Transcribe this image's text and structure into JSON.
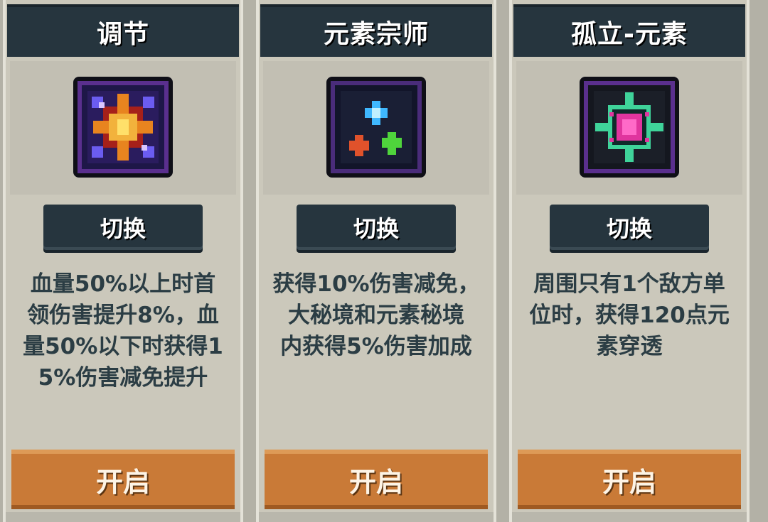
{
  "cards": [
    {
      "title": "调节",
      "icon": "starburst-gem-icon",
      "switch_label": "切换",
      "description": "血量50%以上时首\n领伤害提升8%，血\n量50%以下时获得1\n5%伤害减免提升",
      "open_label": "开启"
    },
    {
      "title": "元素宗师",
      "icon": "three-elements-icon",
      "switch_label": "切换",
      "description": "获得10%伤害减免，\n大秘境和元素秘境\n内获得5%伤害加成",
      "open_label": "开启"
    },
    {
      "title": "孤立-元素",
      "icon": "isolated-orb-icon",
      "switch_label": "切换",
      "description": "周围只有1个敌方单\n位时，获得120点元\n素穿透",
      "open_label": "开启"
    }
  ],
  "colors": {
    "header_bg": "#26353e",
    "panel_bg": "#cbc8bb",
    "text_dark": "#2b3d44",
    "open_button": "#c97a37"
  }
}
